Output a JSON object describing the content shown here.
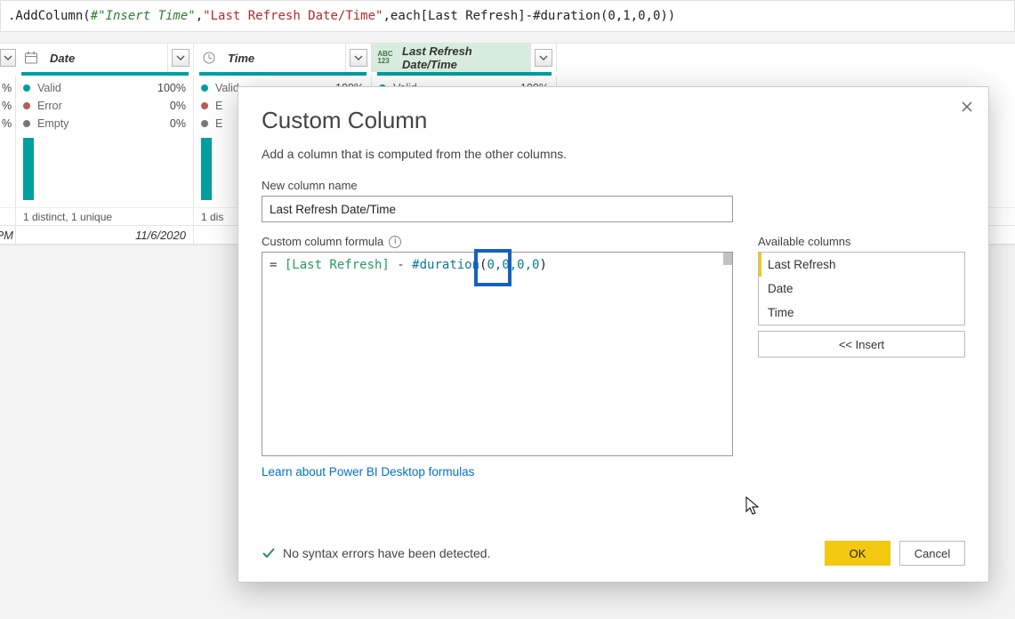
{
  "formula_bar": {
    "prefix": ".AddColumn(",
    "ref1": "#\"Insert Time\"",
    "comma1": ", ",
    "str1": "\"Last Refresh Date/Time\"",
    "comma2": ", ",
    "each": "each ",
    "ref2": "[Last Refresh]",
    "minus": " - ",
    "dur": "#duration",
    "args": "(0,1,0,0)",
    "close": ")"
  },
  "columns": {
    "date": {
      "label": "Date"
    },
    "time": {
      "label": "Time"
    },
    "lr": {
      "label": "Last Refresh Date/Time",
      "type_label": "ABC 123"
    }
  },
  "quality": {
    "valid": "Valid",
    "error": "Error",
    "empty": "Empty",
    "pct100": "100%",
    "pct0": "0%",
    "first_char": "E",
    "pct_suffix": "%"
  },
  "distinct": {
    "text": "1 distinct, 1 unique",
    "prefix": "1 dis"
  },
  "data_row": {
    "pm": "PM",
    "date": "11/6/2020"
  },
  "dialog": {
    "title": "Custom Column",
    "subtitle": "Add a column that is computed from the other columns.",
    "new_col_label": "New column name",
    "new_col_value": "Last Refresh Date/Time",
    "formula_label": "Custom column formula",
    "formula": {
      "eq": "= ",
      "ref": "[Last Refresh]",
      "rest1": " - ",
      "kw": "#duration",
      "open": "(",
      "args": "0,0,0,0",
      "close": ")"
    },
    "avail_label": "Available columns",
    "avail_items": [
      "Last Refresh",
      "Date",
      "Time"
    ],
    "insert_btn": "<< Insert",
    "learn_link": "Learn about Power BI Desktop formulas",
    "status_msg": "No syntax errors have been detected.",
    "ok": "OK",
    "cancel": "Cancel"
  }
}
